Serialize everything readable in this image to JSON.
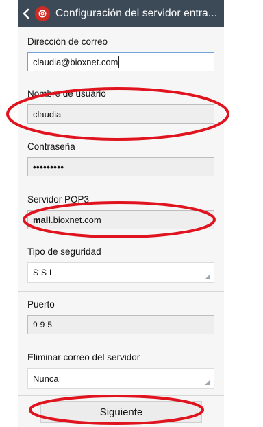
{
  "header": {
    "title": "Configuración del servidor entra...",
    "back_icon": "chevron-left-icon",
    "app_icon": "email-app-icon"
  },
  "form": {
    "email": {
      "label": "Dirección de correo",
      "value": "claudia@bioxnet.com"
    },
    "username": {
      "label": "Nombre de usuario",
      "value": "claudia"
    },
    "password": {
      "label": "Contraseña",
      "value": "•••••••••"
    },
    "pop3_server": {
      "label": "Servidor POP3",
      "value_bold": "mail",
      "value_rest": ".bioxnet.com"
    },
    "security_type": {
      "label": "Tipo de seguridad",
      "value": "SSL"
    },
    "port": {
      "label": "Puerto",
      "value": "995"
    },
    "delete_mail": {
      "label": "Eliminar correo del servidor",
      "value": "Nunca"
    }
  },
  "next_button": {
    "label": "Siguiente"
  },
  "colors": {
    "actionbar": "#3c4a58",
    "highlight_ellipse": "#e0141e",
    "active_field_border": "#6fa3d9"
  }
}
